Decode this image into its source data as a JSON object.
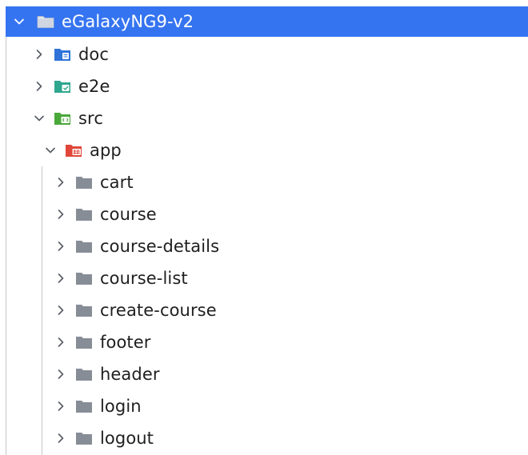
{
  "tree": {
    "root": {
      "label": "eGalaxyNG9-v2",
      "expanded": true,
      "icon": "folder-icon"
    },
    "items": [
      {
        "label": "doc",
        "icon": "doc-folder-icon",
        "expanded": false,
        "color": "#2f73d9"
      },
      {
        "label": "e2e",
        "icon": "test-folder-icon",
        "expanded": false,
        "color": "#2fa68f"
      },
      {
        "label": "src",
        "icon": "source-folder-icon",
        "expanded": true,
        "color": "#4aa83a"
      },
      {
        "label": "app",
        "icon": "module-folder-icon",
        "expanded": true,
        "color": "#e0473a"
      },
      {
        "label": "cart",
        "icon": "folder-icon",
        "expanded": false
      },
      {
        "label": "course",
        "icon": "folder-icon",
        "expanded": false
      },
      {
        "label": "course-details",
        "icon": "folder-icon",
        "expanded": false
      },
      {
        "label": "course-list",
        "icon": "folder-icon",
        "expanded": false
      },
      {
        "label": "create-course",
        "icon": "folder-icon",
        "expanded": false
      },
      {
        "label": "footer",
        "icon": "folder-icon",
        "expanded": false
      },
      {
        "label": "header",
        "icon": "folder-icon",
        "expanded": false
      },
      {
        "label": "login",
        "icon": "folder-icon",
        "expanded": false
      },
      {
        "label": "logout",
        "icon": "folder-icon",
        "expanded": false
      }
    ]
  },
  "colors": {
    "selection": "#3574f0",
    "folder": "#878d96",
    "text": "#1f1f1f"
  }
}
